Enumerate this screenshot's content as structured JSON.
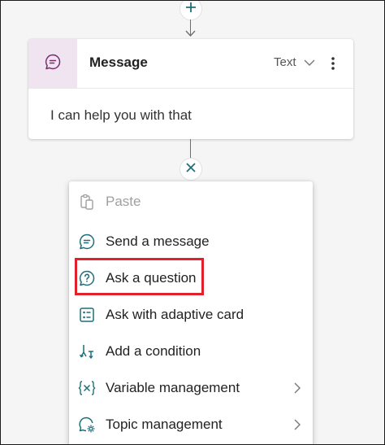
{
  "node": {
    "title": "Message",
    "type_label": "Text",
    "body_text": "I can help you with that"
  },
  "menu": {
    "items": [
      {
        "label": "Paste",
        "icon": "paste-icon",
        "disabled": true
      },
      {
        "label": "Send a message",
        "icon": "message-icon"
      },
      {
        "label": "Ask a question",
        "icon": "question-icon",
        "highlighted": true
      },
      {
        "label": "Ask with adaptive card",
        "icon": "adaptive-card-icon"
      },
      {
        "label": "Add a condition",
        "icon": "condition-icon"
      },
      {
        "label": "Variable management",
        "icon": "variable-icon",
        "submenu": true
      },
      {
        "label": "Topic management",
        "icon": "topic-icon",
        "submenu": true
      }
    ]
  },
  "colors": {
    "accent": "#1f6f7a",
    "message_icon_bg": "#efe4f0",
    "message_icon": "#7a2d72",
    "highlight": "#e0202a"
  }
}
